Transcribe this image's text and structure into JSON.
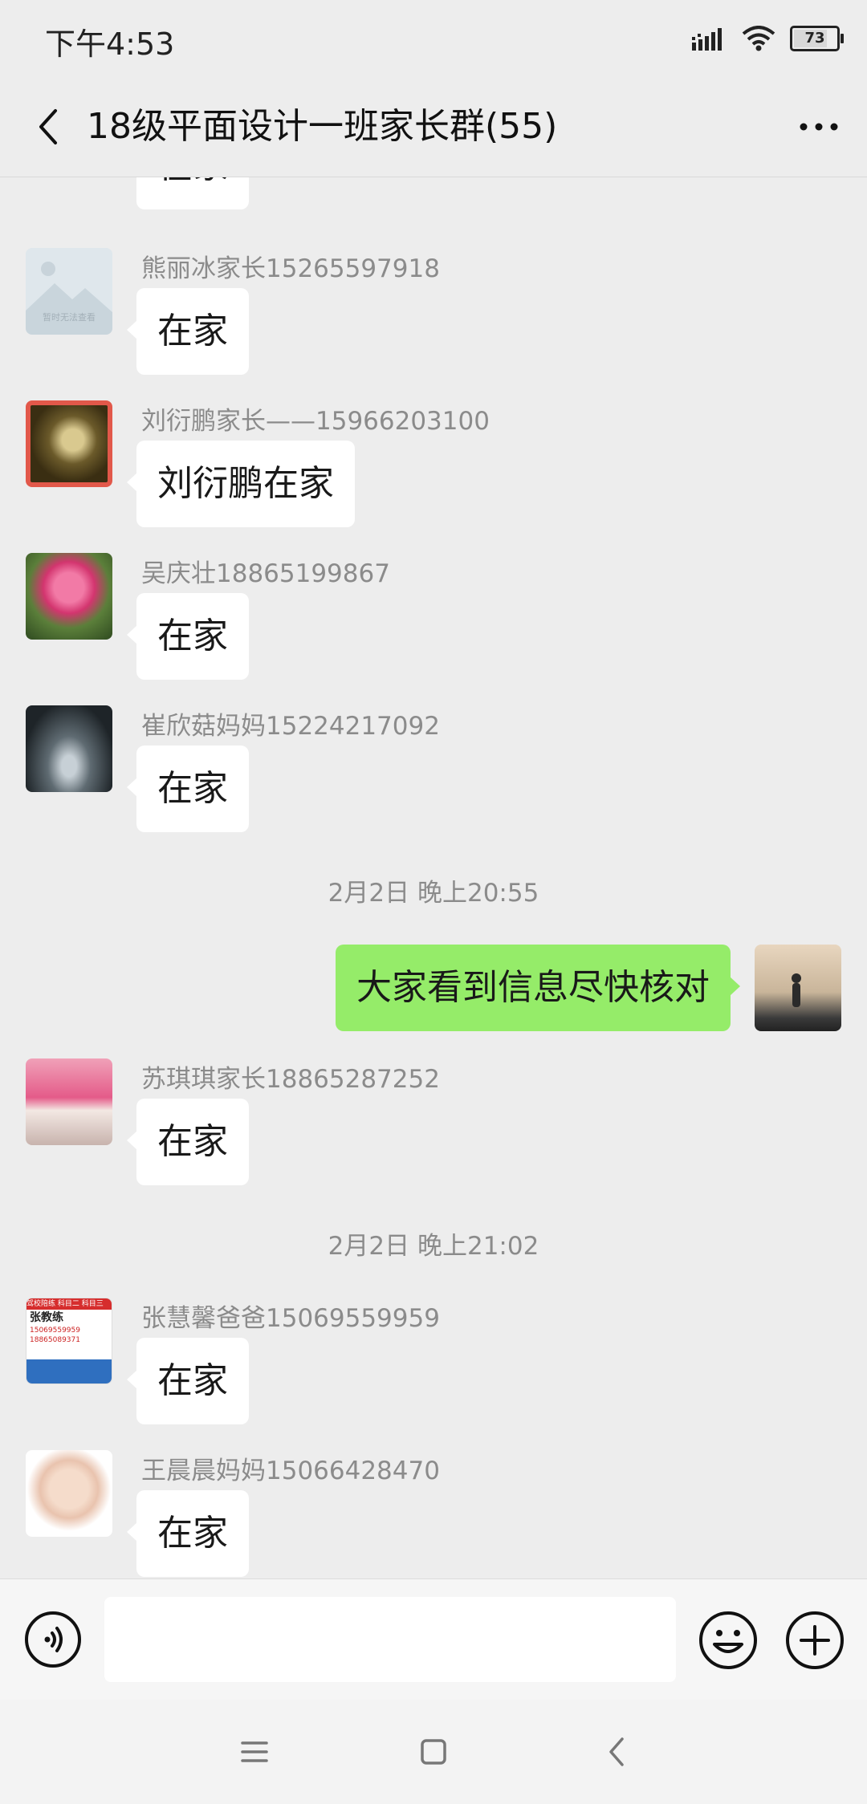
{
  "status_bar": {
    "time": "下午4:53",
    "battery": "73",
    "battery_level": 0.73
  },
  "nav": {
    "title": "18级平面设计一班家长群(55)"
  },
  "messages": [
    {
      "sender": "",
      "text": "在家"
    },
    {
      "sender": "熊丽冰家长15265597918",
      "text": "在家",
      "avatar_text": "暂时无法查看"
    },
    {
      "sender": "刘衍鹏家长——15966203100",
      "text": "刘衍鹏在家"
    },
    {
      "sender": "吴庆壮18865199867",
      "text": "在家"
    },
    {
      "sender": "崔欣菇妈妈15224217092",
      "text": "在家"
    },
    {
      "timestamp": "2月2日 晚上20:55"
    },
    {
      "self": true,
      "text": "大家看到信息尽快核对"
    },
    {
      "sender": "苏琪琪家长18865287252",
      "text": "在家"
    },
    {
      "timestamp": "2月2日 晚上21:02"
    },
    {
      "sender": "张慧馨爸爸15069559959",
      "text": "在家",
      "avatar_text": [
        "驾校陪练 科目二 科目三",
        "张教练",
        "15069559959",
        "18865089371"
      ]
    },
    {
      "sender": "王晨晨妈妈15066428470",
      "text": "在家"
    }
  ],
  "input": {
    "placeholder": "",
    "value": ""
  },
  "colors": {
    "background": "#ededed",
    "self_bubble": "#95ec69",
    "other_bubble": "#ffffff"
  },
  "icons": {
    "back": "chevron-left-icon",
    "more": "more-dots-icon",
    "voice": "voice-icon",
    "emoji": "emoji-icon",
    "plus": "plus-icon",
    "menu": "menu-icon",
    "home": "home-icon",
    "sys_back": "back-icon"
  }
}
